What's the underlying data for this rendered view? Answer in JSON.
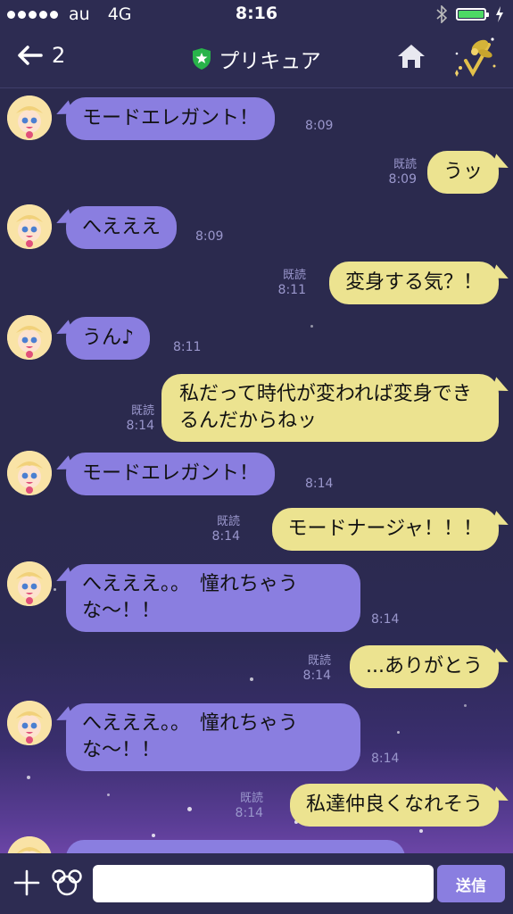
{
  "colors": {
    "background": "#2b2a4e",
    "left_bubble": "#8a7ee0",
    "right_bubble": "#ece390",
    "accent_shield": "#28b34a"
  },
  "status_bar": {
    "carrier": "au",
    "network": "4G",
    "time": "8:16"
  },
  "header": {
    "back_count": "2",
    "title": "プリキュア",
    "icons": [
      "back-arrow-icon",
      "shield-star-icon",
      "home-icon",
      "fairy-icon"
    ]
  },
  "messages": [
    {
      "side": "left",
      "text": "モードエレガント！",
      "time": "8:09"
    },
    {
      "side": "right",
      "text": "うッ",
      "read": "既読",
      "time": "8:09"
    },
    {
      "side": "left",
      "text": "へえええ",
      "time": "8:09"
    },
    {
      "side": "right",
      "text": "変身する気？！",
      "read": "既読",
      "time": "8:11"
    },
    {
      "side": "left",
      "text": "うん♪",
      "time": "8:11"
    },
    {
      "side": "right",
      "text": "私だって時代が変われば変身できるんだからねッ",
      "read": "既読",
      "time": "8:14"
    },
    {
      "side": "left",
      "text": "モードエレガント！",
      "time": "8:14"
    },
    {
      "side": "right",
      "text": "モードナージャ！！！",
      "read": "既読",
      "time": "8:14"
    },
    {
      "side": "left",
      "text": "へえええ。。　憧れちゃうな〜！！",
      "time": "8:14"
    },
    {
      "side": "right",
      "text": "...ありがとう",
      "read": "既読",
      "time": "8:14"
    },
    {
      "side": "left",
      "text": "へえええ。。　憧れちゃうな〜！！",
      "time": "8:14"
    },
    {
      "side": "right",
      "text": "私達仲良くなれそう",
      "read": "既読",
      "time": "8:14"
    }
  ],
  "input_bar": {
    "placeholder": "",
    "send_label": "送信",
    "icons": [
      "plus-icon",
      "mouse-icon"
    ]
  }
}
